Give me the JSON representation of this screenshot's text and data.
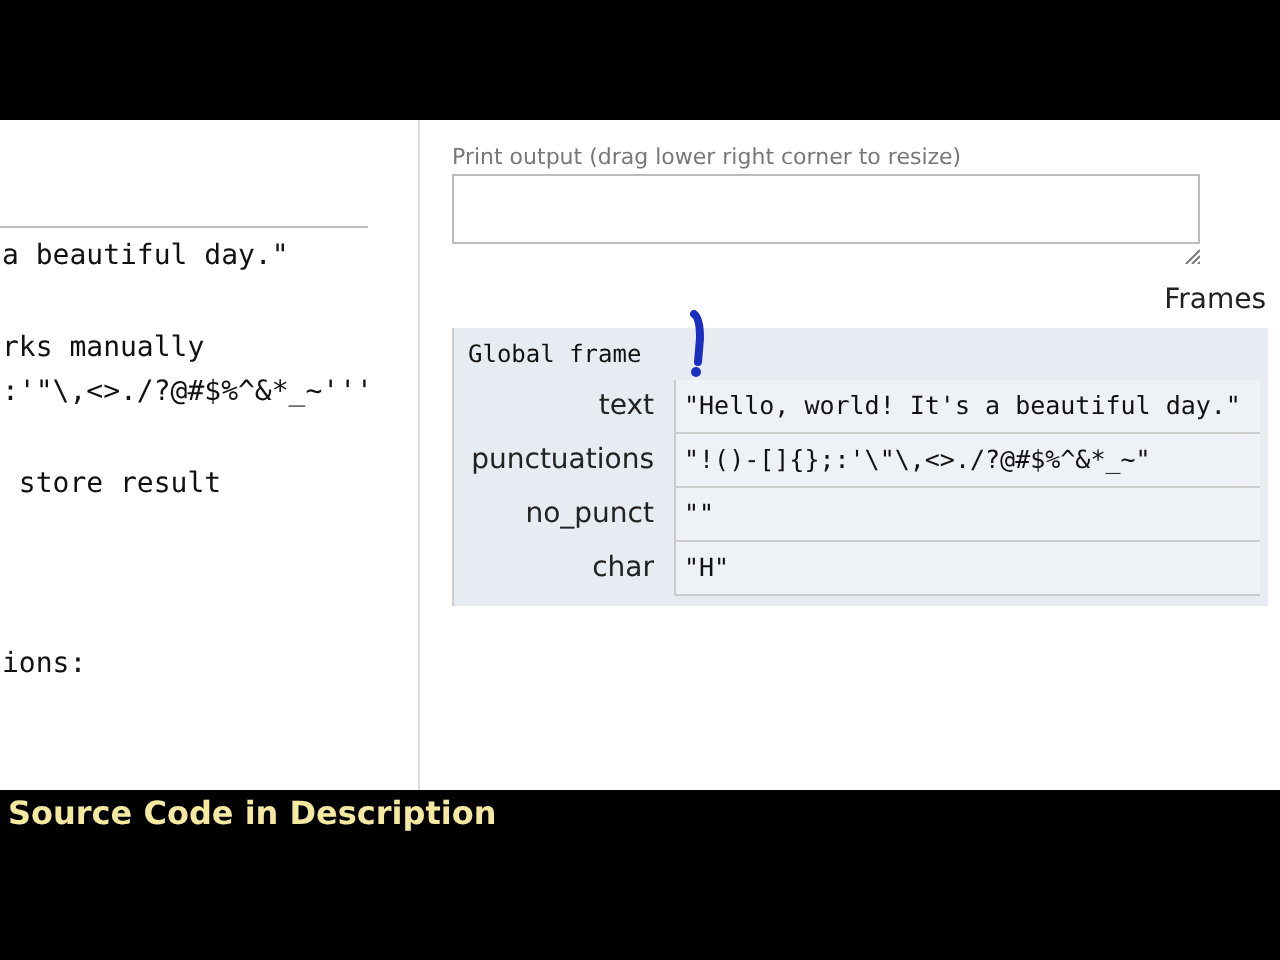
{
  "code_lines": [
    "a beautiful day.\"",
    "rks manually",
    ":'\"\\,<>./?@#$%^&*_~'''",
    " store result",
    "ions:"
  ],
  "print_output": {
    "label": "Print output (drag lower right corner to resize)"
  },
  "frames": {
    "heading": "Frames",
    "title": "Global frame",
    "variables": [
      {
        "name": "text",
        "value": "\"Hello, world! It's a beautiful day.\""
      },
      {
        "name": "punctuations",
        "value": "\"!()-[]{};:'\\\"\\,<>./?@#$%^&*_~\""
      },
      {
        "name": "no_punct",
        "value": "\"\""
      },
      {
        "name": "char",
        "value": "\"H\""
      }
    ]
  },
  "banner": "Source Code in  Description"
}
